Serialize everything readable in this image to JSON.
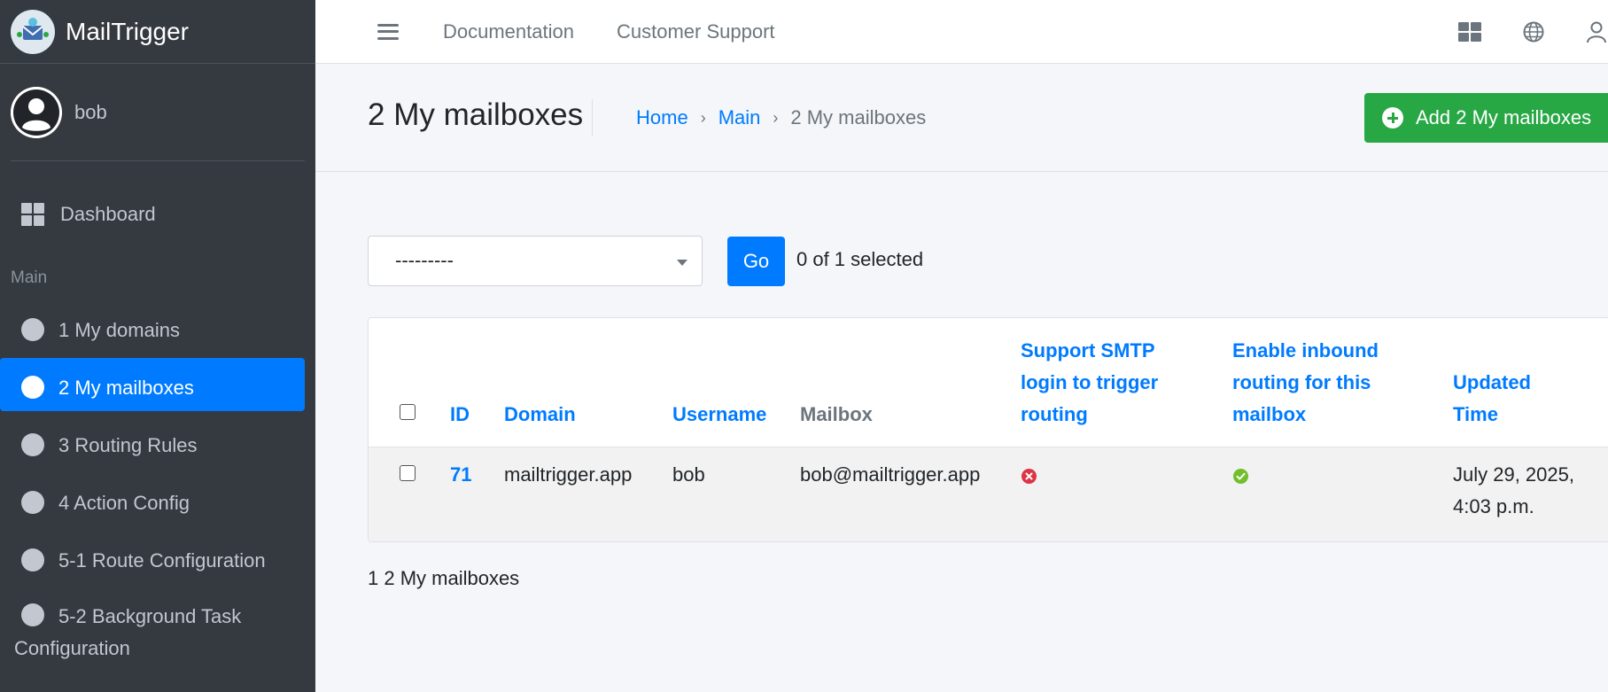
{
  "brand": {
    "name": "MailTrigger"
  },
  "user": {
    "name": "bob"
  },
  "sidebar": {
    "dashboard_label": "Dashboard",
    "section_header": "Main",
    "items": [
      {
        "label": "1 My domains"
      },
      {
        "label": "2 My mailboxes",
        "active": true
      },
      {
        "label": "3 Routing Rules"
      },
      {
        "label": "4 Action Config"
      },
      {
        "label": "5-1 Route Configuration"
      },
      {
        "label_line1": "5-2 Background Task",
        "label_line2": "Configuration"
      }
    ]
  },
  "topbar": {
    "links": [
      "Documentation",
      "Customer Support"
    ],
    "icons": [
      "hamburger-menu-icon",
      "grid-icon",
      "globe-icon",
      "user-icon"
    ]
  },
  "page": {
    "title": "2 My mailboxes",
    "breadcrumb": [
      "Home",
      "Main",
      "2 My mailboxes"
    ],
    "add_button_label": "Add 2 My mailboxes"
  },
  "actions": {
    "select_value": "---------",
    "go_label": "Go",
    "selected_text": "0 of 1 selected"
  },
  "table": {
    "headers": {
      "id": "ID",
      "domain": "Domain",
      "username": "Username",
      "mailbox": "Mailbox",
      "smtp_line1": "Support SMTP",
      "smtp_line2": "login to trigger",
      "smtp_line3": "routing",
      "inbound_line1": "Enable inbound",
      "inbound_line2": "routing for this",
      "inbound_line3": "mailbox",
      "updated_line1": "Updated",
      "updated_line2": "Time"
    },
    "rows": [
      {
        "id": "71",
        "domain": "mailtrigger.app",
        "username": "bob",
        "mailbox": "bob@mailtrigger.app",
        "smtp_login": false,
        "inbound_routing": true,
        "updated_line1": "July 29, 2025,",
        "updated_line2": "4:03 p.m."
      }
    ]
  },
  "footer": {
    "count_text": "1 2 My mailboxes"
  },
  "colors": {
    "sidebar_bg": "#343a40",
    "primary": "#007bff",
    "success": "#28a745",
    "danger": "#dc3545",
    "check_green": "#70bf2b"
  }
}
